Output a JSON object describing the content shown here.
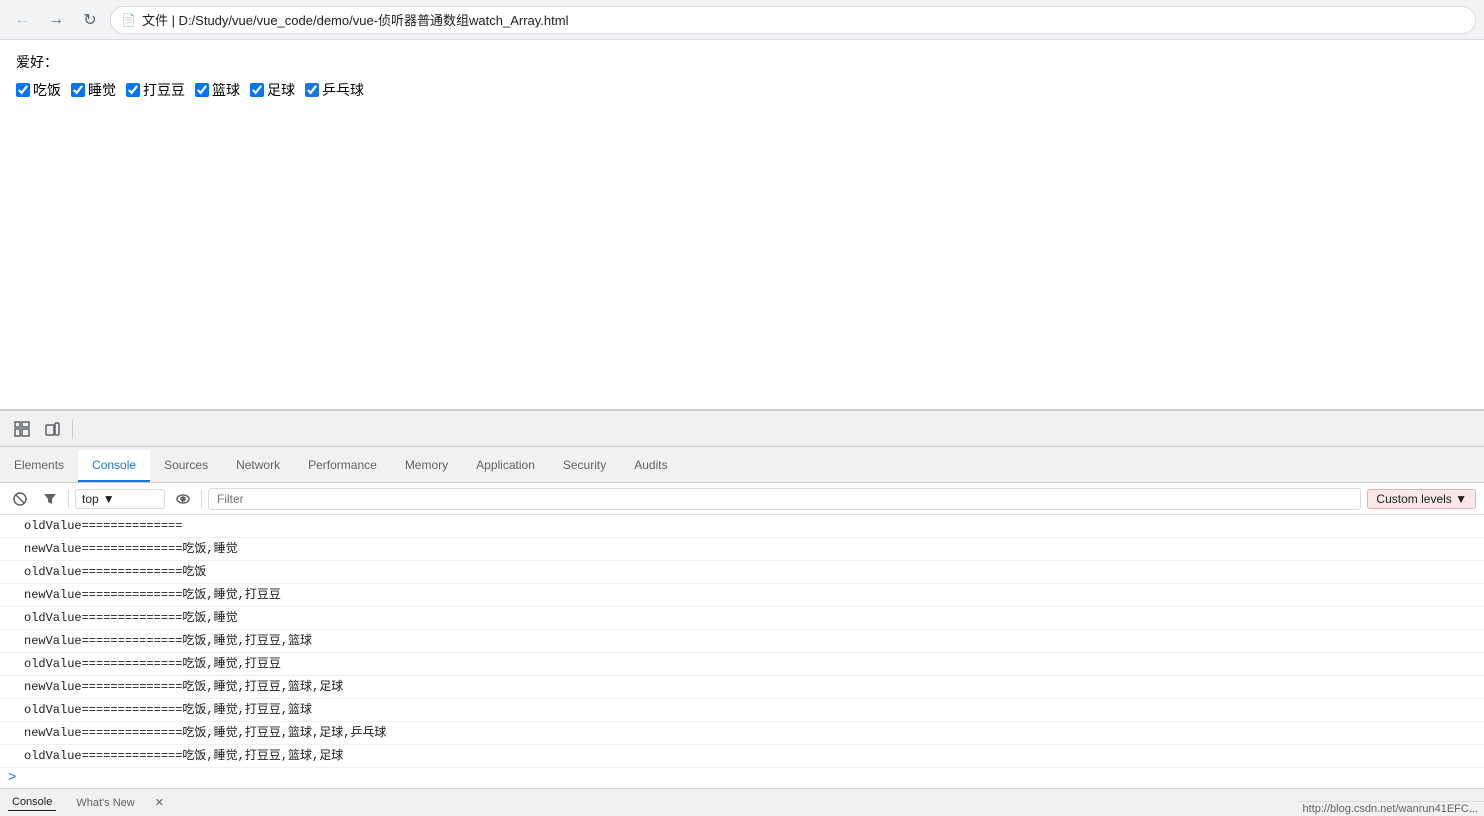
{
  "browser": {
    "address": "文件 | D:/Study/vue/vue_code/demo/vue-侦听器普通数组watch_Array.html",
    "address_icon": "🔒"
  },
  "page": {
    "label": "爱好：",
    "checkboxes": [
      {
        "id": "cb1",
        "label": "吃饭",
        "checked": true
      },
      {
        "id": "cb2",
        "label": "睡觉",
        "checked": true
      },
      {
        "id": "cb3",
        "label": "打豆豆",
        "checked": true
      },
      {
        "id": "cb4",
        "label": "篮球",
        "checked": true
      },
      {
        "id": "cb5",
        "label": "足球",
        "checked": true
      },
      {
        "id": "cb6",
        "label": "乒乓球",
        "checked": true
      }
    ]
  },
  "devtools": {
    "tabs": [
      {
        "label": "Elements",
        "active": false
      },
      {
        "label": "Console",
        "active": true
      },
      {
        "label": "Sources",
        "active": false
      },
      {
        "label": "Network",
        "active": false
      },
      {
        "label": "Performance",
        "active": false
      },
      {
        "label": "Memory",
        "active": false
      },
      {
        "label": "Application",
        "active": false
      },
      {
        "label": "Security",
        "active": false
      },
      {
        "label": "Audits",
        "active": false
      }
    ],
    "filter_placeholder": "Filter",
    "top_dropdown_value": "top",
    "custom_levels_label": "Custom levels ▼",
    "console_lines": [
      "oldValue==============",
      "newValue==============吃饭,睡觉",
      "oldValue==============吃饭",
      "newValue==============吃饭,睡觉,打豆豆",
      "oldValue==============吃饭,睡觉",
      "newValue==============吃饭,睡觉,打豆豆,篮球",
      "oldValue==============吃饭,睡觉,打豆豆",
      "newValue==============吃饭,睡觉,打豆豆,篮球,足球",
      "oldValue==============吃饭,睡觉,打豆豆,篮球",
      "newValue==============吃饭,睡觉,打豆豆,篮球,足球,乒乓球",
      "oldValue==============吃饭,睡觉,打豆豆,篮球,足球"
    ],
    "bottom_tabs": [
      {
        "label": "Console",
        "active": true
      },
      {
        "label": "What's New",
        "active": false
      }
    ]
  },
  "status_bar": {
    "text": "http://blog.csdn.net/wanrun41EFC..."
  }
}
